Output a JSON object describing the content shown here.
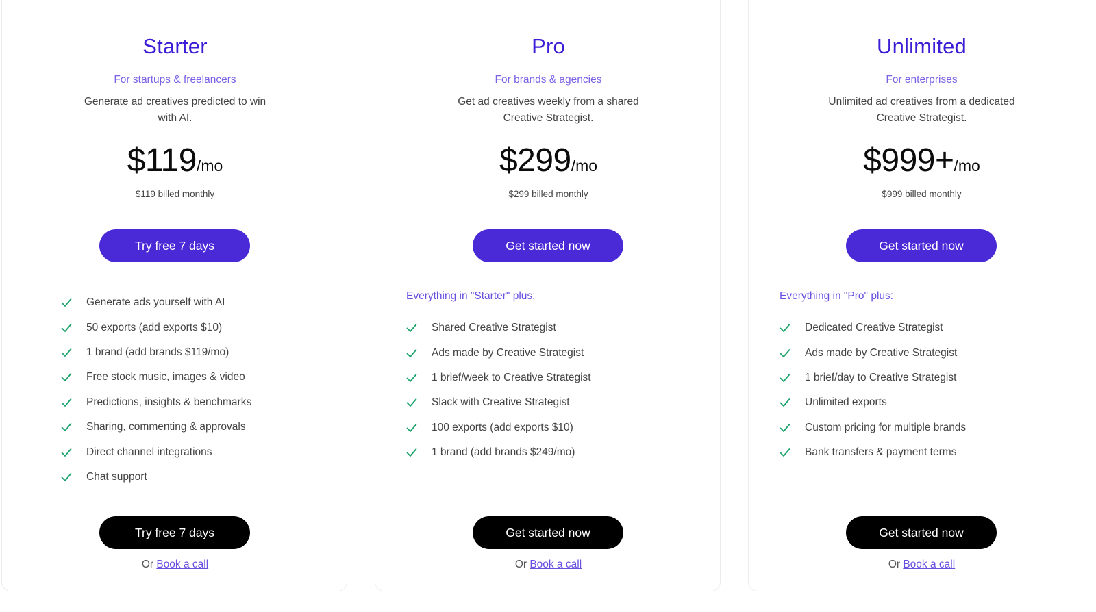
{
  "colors": {
    "accent": "#4a2ad7",
    "plan_title": "#3d1ed6",
    "subtitle": "#7b61e6",
    "check": "#1aa36a",
    "dark_button": "#000000"
  },
  "plans": [
    {
      "name": "Starter",
      "audience": "For startups & freelancers",
      "description": "Generate ad creatives predicted to win with AI.",
      "price": "$119",
      "unit": "/mo",
      "billed": "$119 billed monthly",
      "cta_top": "Try free 7 days",
      "features_heading": "",
      "features": [
        "Generate ads yourself with AI",
        "50 exports (add exports $10)",
        "1 brand (add brands $119/mo)",
        "Free stock music, images & video",
        "Predictions, insights & benchmarks",
        "Sharing, commenting & approvals",
        "Direct channel integrations",
        "Chat support"
      ],
      "cta_bottom": "Try free 7 days",
      "or_text": "Or",
      "book_link": "Book a call"
    },
    {
      "name": "Pro",
      "audience": "For brands & agencies",
      "description": "Get ad creatives weekly from a shared Creative Strategist.",
      "price": "$299",
      "unit": "/mo",
      "billed": "$299 billed monthly",
      "cta_top": "Get started now",
      "features_heading": "Everything in \"Starter\" plus:",
      "features": [
        "Shared Creative Strategist",
        "Ads made by Creative Strategist",
        "1 brief/week to Creative Strategist",
        "Slack with Creative Strategist",
        "100 exports (add exports $10)",
        "1 brand (add brands $249/mo)"
      ],
      "cta_bottom": "Get started now",
      "or_text": "Or",
      "book_link": "Book a call"
    },
    {
      "name": "Unlimited",
      "audience": "For enterprises",
      "description": "Unlimited ad creatives from a dedicated Creative Strategist.",
      "price": "$999+",
      "unit": "/mo",
      "billed": "$999 billed monthly",
      "cta_top": "Get started now",
      "features_heading": "Everything in \"Pro\" plus:",
      "features": [
        "Dedicated Creative Strategist",
        "Ads made by Creative Strategist",
        "1 brief/day to Creative Strategist",
        "Unlimited exports",
        "Custom pricing for multiple brands",
        "Bank transfers & payment terms"
      ],
      "cta_bottom": "Get started now",
      "or_text": "Or",
      "book_link": "Book a call"
    }
  ]
}
